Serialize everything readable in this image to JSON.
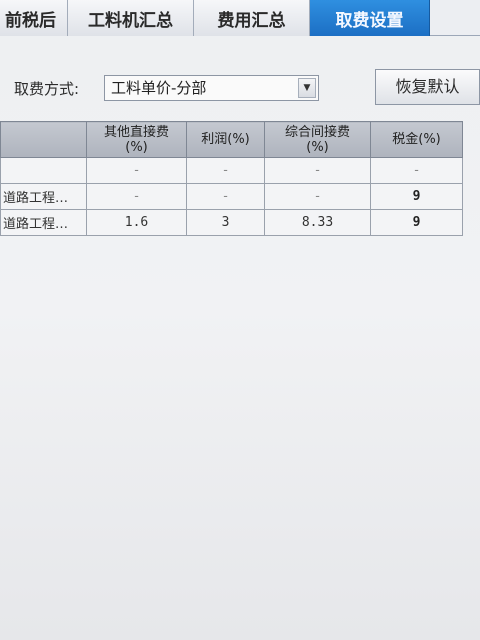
{
  "tabs": [
    {
      "label": "前税后",
      "active": false
    },
    {
      "label": "工料机汇总",
      "active": false
    },
    {
      "label": "费用汇总",
      "active": false
    },
    {
      "label": "取费设置",
      "active": true
    }
  ],
  "toolbar": {
    "fee_method_label": "取费方式:",
    "fee_method_value": "工料单价-分部",
    "restore_default_label": "恢复默认"
  },
  "table": {
    "columns": [
      {
        "label": "",
        "unit": ""
      },
      {
        "label": "其他直接费",
        "unit": "(%)"
      },
      {
        "label": "利润(%)",
        "unit": ""
      },
      {
        "label": "综合间接费",
        "unit": "(%)"
      },
      {
        "label": "税金(%)",
        "unit": ""
      }
    ],
    "rows": [
      {
        "name": "",
        "other_direct": "-",
        "profit": "-",
        "indirect": "-",
        "tax": "-"
      },
      {
        "name": "道路工程…",
        "other_direct": "-",
        "profit": "-",
        "indirect": "-",
        "tax": "9"
      },
      {
        "name": "道路工程…",
        "other_direct": "1.6",
        "profit": "3",
        "indirect": "8.33",
        "tax": "9"
      }
    ]
  },
  "colors": {
    "active_tab": "#1c6fc4",
    "header_bg": "#b5bac3"
  }
}
